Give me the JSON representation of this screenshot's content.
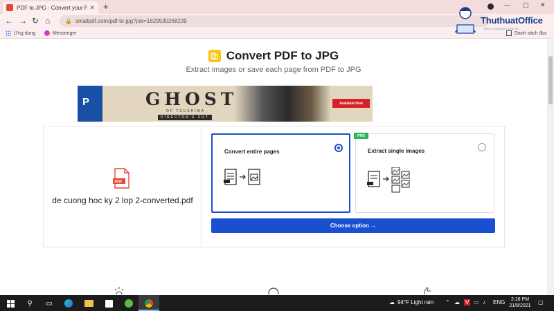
{
  "browser": {
    "tab_title": "PDF to JPG - Convert your PDFs",
    "new_tab": "+",
    "url": "smallpdf.com/pdf-to-jpg?job=1629530268239",
    "bookmarks": {
      "apps": "Ứng dụng",
      "messenger": "Messenger",
      "reading_list": "Danh sách đọc"
    }
  },
  "logo": {
    "text": "ThuthuatOffice",
    "sub": "TRI KY CUA DAN CONG SO"
  },
  "page": {
    "title": "Convert PDF to JPG",
    "subtitle": "Extract images or save each page from PDF to JPG",
    "ad": {
      "title": "GHOST",
      "sub": "OF TSUSHIMA",
      "sub2": "DIRECTOR'S CUT",
      "cta": "Available Now"
    },
    "file_name": "de cuong hoc ky 2 lop 2-converted.pdf",
    "options": [
      {
        "label": "Convert entire pages",
        "selected": true
      },
      {
        "label": "Extract single images",
        "selected": false,
        "badge": "PRO"
      }
    ],
    "choose_button": "Choose option →"
  },
  "taskbar": {
    "weather": "94°F  Light rain",
    "lang": "ENG",
    "time": "2:18 PM",
    "date": "21/8/2021"
  },
  "colors": {
    "accent": "#1a4fcf",
    "pdf_red": "#e6463b",
    "pro_green": "#2ab45e",
    "brand_yellow": "#f9c510"
  }
}
